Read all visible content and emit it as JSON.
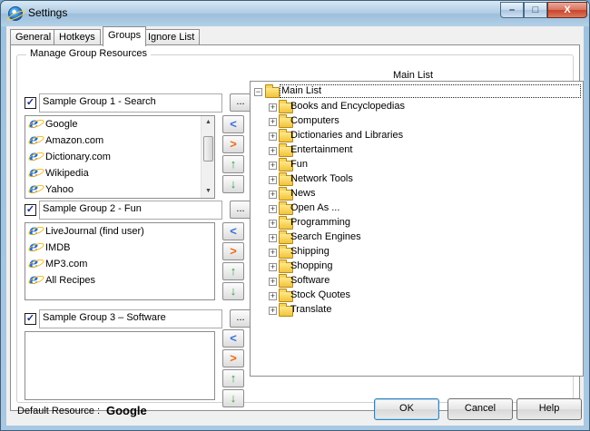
{
  "window": {
    "title": "Settings",
    "minimize_label": "–",
    "maximize_label": "□",
    "close_label": "X"
  },
  "tabs": [
    {
      "label": "General",
      "active": false
    },
    {
      "label": "Hotkeys",
      "active": false
    },
    {
      "label": "Groups",
      "active": true
    },
    {
      "label": "Ignore List",
      "active": false
    }
  ],
  "groupbox_title": "Manage Group Resources",
  "main_list_title": "Main List",
  "groups": [
    {
      "name": "Sample Group 1 - Search",
      "checked": true,
      "items": [
        "Google",
        "Amazon.com",
        "Dictionary.com",
        "Wikipedia",
        "Yahoo"
      ]
    },
    {
      "name": "Sample Group 2 - Fun",
      "checked": true,
      "items": [
        "LiveJournal (find user)",
        "IMDB",
        "MP3.com",
        "All Recipes"
      ]
    },
    {
      "name": "Sample Group 3 – Software",
      "checked": true,
      "items": []
    }
  ],
  "buttons": {
    "dots": "...",
    "move_left": "<",
    "move_right": ">",
    "move_up": "↑",
    "move_down": "↓",
    "ok": "OK",
    "cancel": "Cancel",
    "help": "Help"
  },
  "tree": {
    "root": "Main List",
    "items": [
      "Books and Encyclopedias",
      "Computers",
      "Dictionaries and Libraries",
      "Entertainment",
      "Fun",
      "Network Tools",
      "News",
      "Open As ...",
      "Programming",
      "Search Engines",
      "Shipping",
      "Shopping",
      "Software",
      "Stock Quotes",
      "Translate"
    ]
  },
  "default_resource": {
    "label": "Default Resource :",
    "value": "Google"
  },
  "colors": {
    "arrow_blue": "#3a6fd8",
    "arrow_orange": "#ef6a12",
    "arrow_green": "#2aa33a",
    "folder": "#f2c33a"
  }
}
